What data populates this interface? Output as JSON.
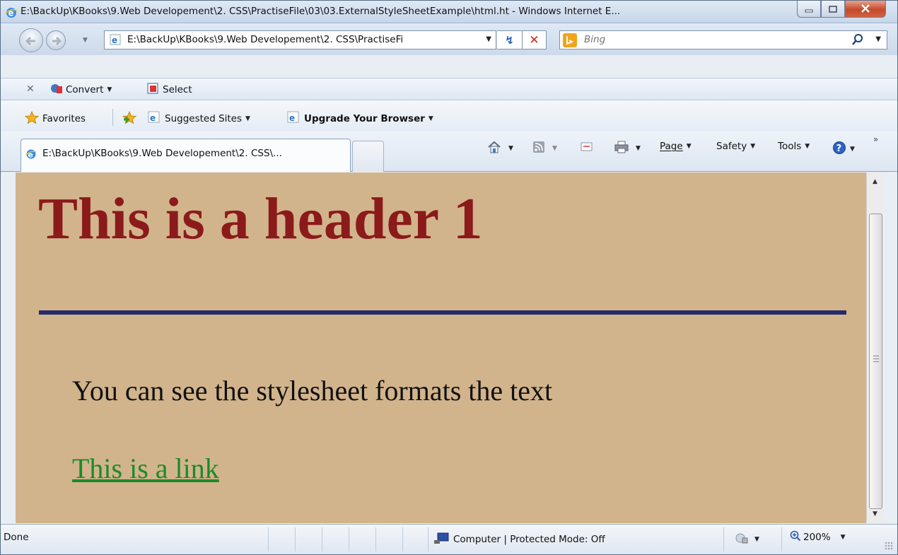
{
  "window": {
    "title": "E:\\BackUp\\KBooks\\9.Web Developement\\2. CSS\\PractiseFile\\03\\03.ExternalStyleSheetExample\\html.ht - Windows Internet E..."
  },
  "address_bar": {
    "url": "E:\\BackUp\\KBooks\\9.Web Developement\\2. CSS\\PractiseFi"
  },
  "search": {
    "placeholder": "Bing"
  },
  "command_bar": {
    "convert_label": "Convert",
    "select_label": "Select"
  },
  "favorites_bar": {
    "favorites_label": "Favorites",
    "suggested_sites_label": "Suggested Sites",
    "upgrade_label": "Upgrade Your Browser"
  },
  "tabs": [
    {
      "label": "E:\\BackUp\\KBooks\\9.Web Developement\\2. CSS\\..."
    }
  ],
  "tools": {
    "page_label": "Page",
    "safety_label": "Safety",
    "tools_label": "Tools"
  },
  "content": {
    "heading": "This is a header 1",
    "paragraph": "You can see the stylesheet formats the text",
    "link_text": "This is a link"
  },
  "status_bar": {
    "status": "Done",
    "zone": "Computer | Protected Mode: Off",
    "zoom": "200%"
  },
  "colors": {
    "page_background": "#d2b48c",
    "heading": "#8b1a1a",
    "rule": "#262a6b",
    "link": "#1b8a2a"
  }
}
